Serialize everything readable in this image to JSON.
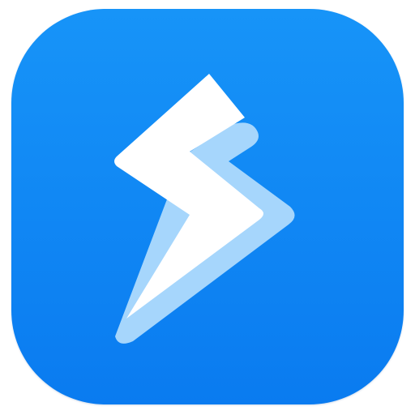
{
  "app_icon": {
    "glyph": "lightning-bolt-icon",
    "colors": {
      "background_top": "#1794F8",
      "background_bottom": "#0A7BF0",
      "bolt_front": "#FFFFFF",
      "bolt_back": "#A6D6FC"
    }
  }
}
